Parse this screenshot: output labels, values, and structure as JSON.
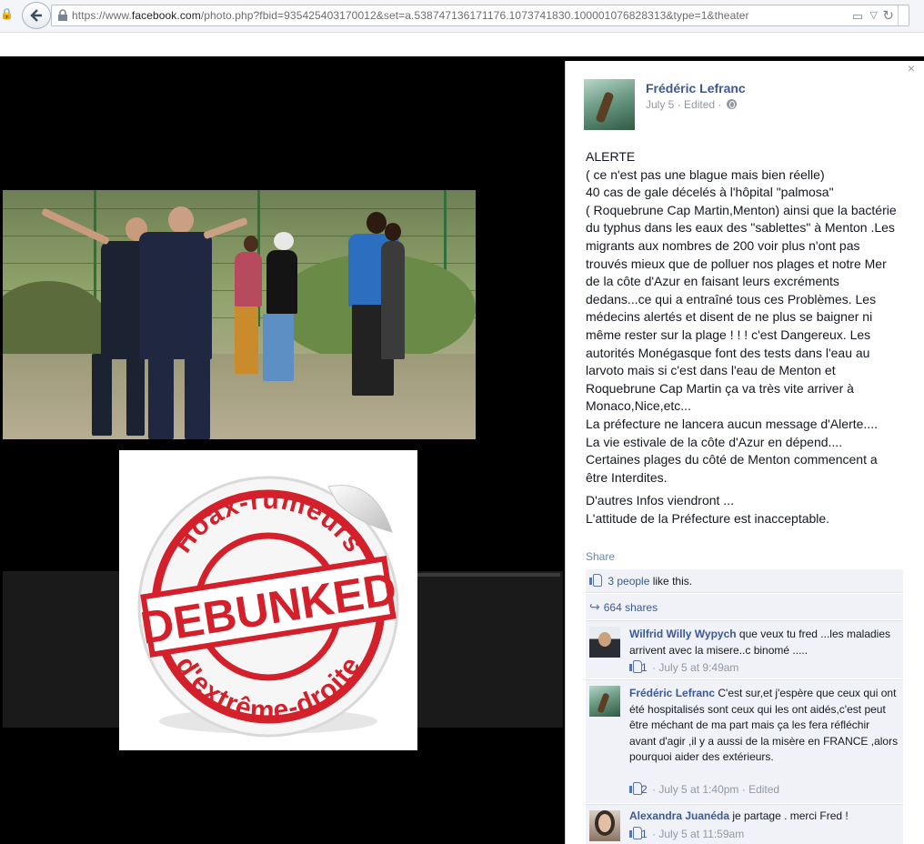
{
  "browser": {
    "url_prefix": "https://www.",
    "url_domain": "facebook.com",
    "url_rest": "/photo.php?fbid=935425403170012&set=a.538747136171176.1073741830.100001076828313&type=1&theater",
    "back_icon": "back-arrow-icon",
    "lock_icon": "lock-icon",
    "reader_icon": "reader-view-icon",
    "reload_icon": "reload-icon"
  },
  "sticker": {
    "top_text": "Hoax-rumeurs",
    "middle_text": "DEBUNKED",
    "bottom_text": "d'extrême-droite",
    "color": "#d4202a"
  },
  "post": {
    "author": "Frédéric Lefranc",
    "date": "July 5",
    "edited": "Edited",
    "separator": "·",
    "text_lines": [
      "ALERTE",
      "( ce n'est pas une blague mais bien réelle)",
      "40 cas de gale décelés à l'hôpital \"palmosa\"",
      "( Roquebrune Cap Martin,Menton) ainsi que la bactérie",
      "du typhus dans les eaux des \"sablettes\" à Menton .Les",
      "migrants aux nombres de 200 voir plus n'ont pas",
      "trouvés mieux que de polluer nos plages et notre Mer",
      "de la côte d'Azur en faisant leurs excréments",
      "dedans...ce qui a entraîné tous ces Problèmes. Les",
      "médecins alertés et disent de ne plus se baigner ni",
      "même rester sur la plage ! ! ! c'est Dangereux. Les",
      "autorités Monégasque font des tests dans l'eau au",
      "larvoto mais si c'est dans l'eau de Menton et",
      "Roquebrune Cap Martin ça va très vite arriver à",
      "Monaco,Nice,etc...",
      "La préfecture ne lancera aucun message d'Alerte....",
      "La vie estivale de la côte d'Azur en dépend....",
      "Certaines plages du côté de Menton commencent a",
      "être Interdites."
    ],
    "text_lines_2": [
      "D'autres Infos viendront ...",
      "L'attitude de la Préfecture est inacceptable."
    ],
    "share_label": "Share",
    "likes_count": "3 people",
    "likes_suffix": " like this.",
    "shares_count": "664 shares",
    "close_label": "×"
  },
  "comments": [
    {
      "name": "Wilfrid Willy Wypych",
      "text": " que veux tu fred ...les maladies arrivent avec la misere..c binomé .....",
      "likes": "1",
      "meta": "· July 5 at 9:49am"
    },
    {
      "name": "Frédéric Lefranc",
      "text": " C'est sur,et j'espère que ceux qui ont été hospitalisés sont ceux qui les ont aidés,c'est peut être méchant de ma part mais ça les fera réfléchir avant d'agir ,il y a aussi de la misère en FRANCE ,alors pourquoi aider des extérieurs.",
      "likes": "2",
      "meta": "· July 5 at 1:40pm · Edited"
    },
    {
      "name": "Alexandra Juanéda",
      "text": " je partage . merci Fred !",
      "likes": "1",
      "meta": "· July 5 at 11:59am"
    }
  ],
  "colors": {
    "facebook_blue": "#3b5998",
    "link_blue": "#6d84b4",
    "meta_gray": "#9197a3",
    "theater_bg": "#000000",
    "sticker_red": "#d4202a"
  }
}
